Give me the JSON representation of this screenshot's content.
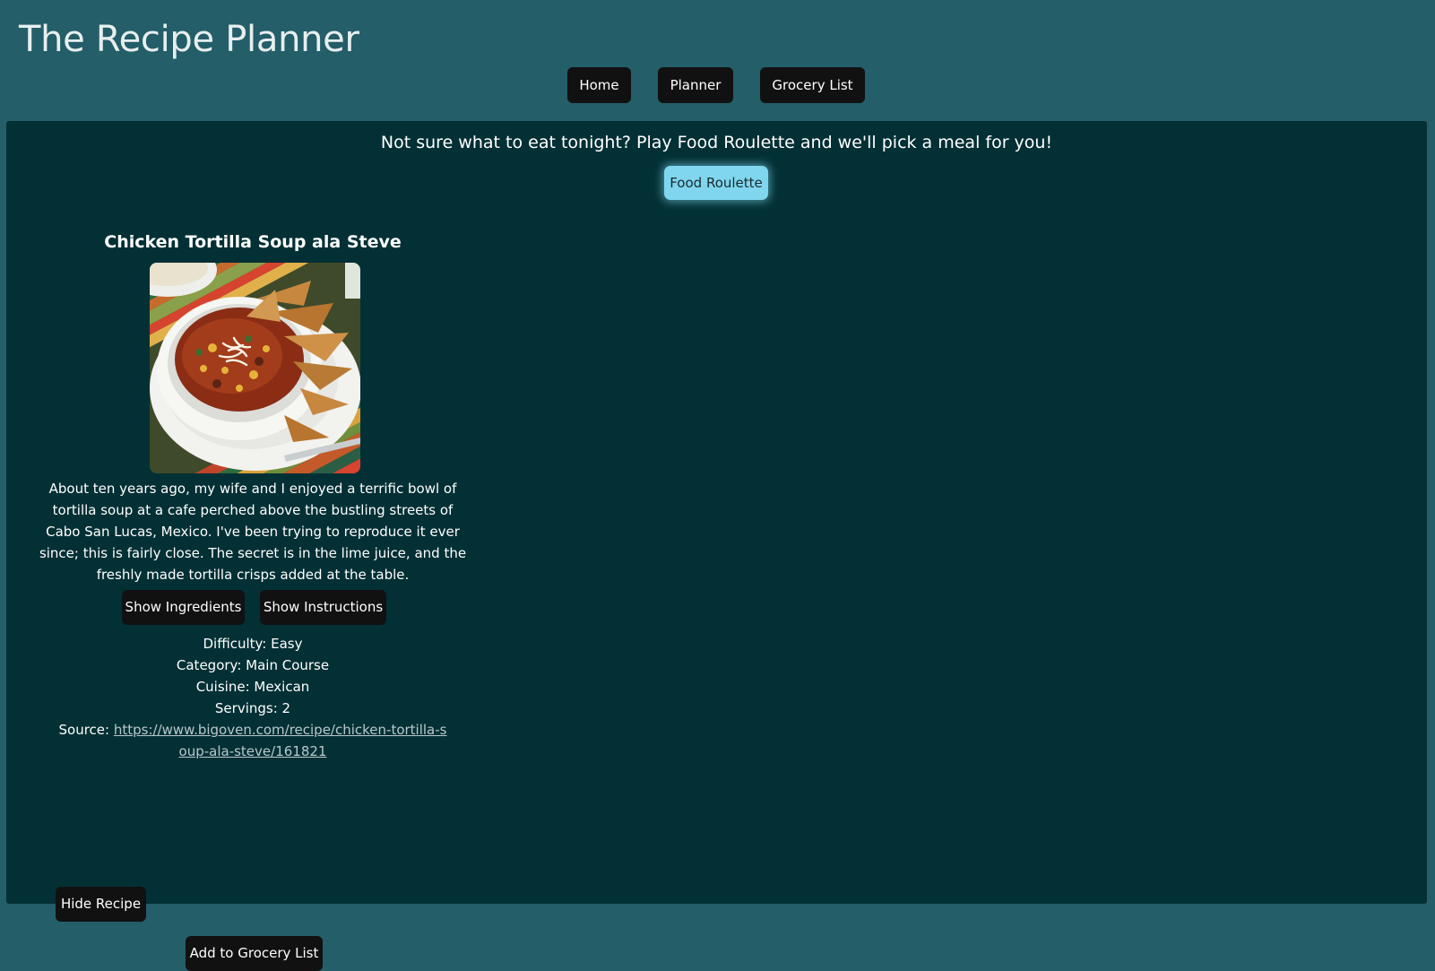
{
  "header": {
    "title": "The Recipe Planner"
  },
  "nav": {
    "items": [
      {
        "label": "Home"
      },
      {
        "label": "Planner"
      },
      {
        "label": "Grocery List"
      }
    ]
  },
  "main": {
    "tagline": "Not sure what to eat tonight? Play Food Roulette and we'll pick a meal for you!",
    "roulette_label": "Food Roulette"
  },
  "recipe": {
    "title": "Chicken Tortilla Soup ala Steve",
    "description": "About ten years ago, my wife and I enjoyed a terrific bowl of tortilla soup at a cafe perched above the bustling streets of Cabo San Lucas, Mexico. I've been trying to reproduce it ever since; this is fairly close. The secret is in the lime juice, and the freshly made tortilla crisps added at the table.",
    "show_ingredients_label": "Show Ingredients",
    "show_instructions_label": "Show Instructions",
    "difficulty": "Difficulty: Easy",
    "category": "Category: Main Course",
    "cuisine": "Cuisine: Mexican",
    "servings": "Servings: 2",
    "source_label": "Source:",
    "source_url": "https://www.bigoven.com/recipe/chicken-tortilla-soup-ala-steve/161821",
    "hide_label": "Hide Recipe",
    "add_grocery_label": "Add to Grocery List"
  },
  "colors": {
    "header_bg": "#235e69",
    "panel_bg": "#033035",
    "button_dark": "#111111",
    "accent_button": "#7fd6ee"
  }
}
